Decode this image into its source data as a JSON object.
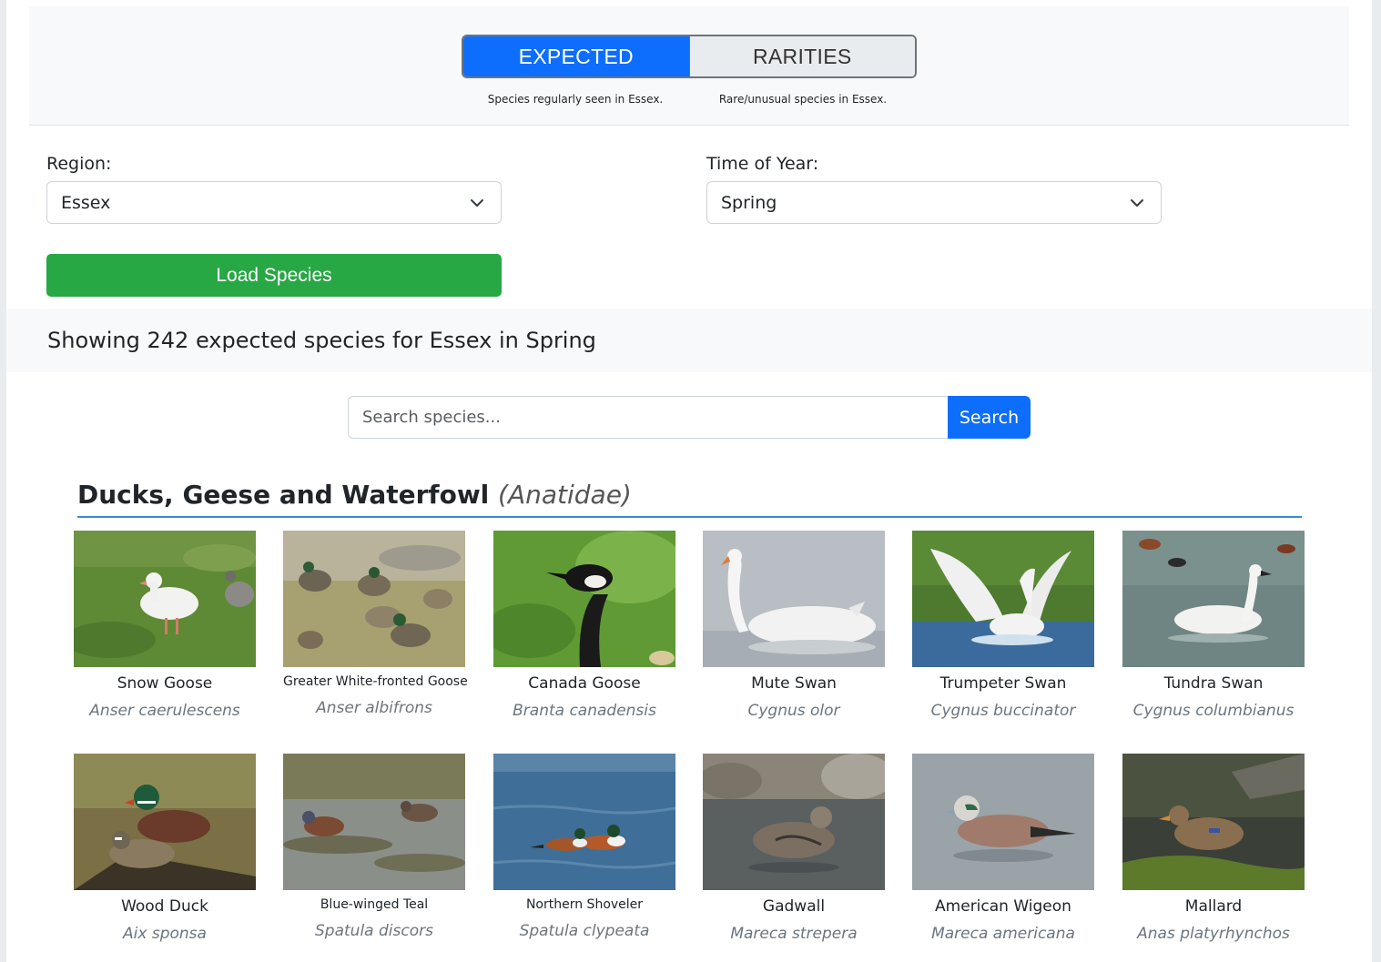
{
  "mode_toggle": {
    "expected_label": "EXPECTED",
    "rarities_label": "RARITIES",
    "expected_desc": "Species regularly seen in Essex.",
    "rarities_desc": "Rare/unusual species in Essex.",
    "active": "expected"
  },
  "filters": {
    "region_label": "Region:",
    "region_value": "Essex",
    "time_label": "Time of Year:",
    "time_value": "Spring",
    "load_label": "Load Species"
  },
  "status": {
    "text": "Showing 242 expected species for Essex in Spring"
  },
  "search": {
    "placeholder": "Search species...",
    "button_label": "Search"
  },
  "family": {
    "common": "Ducks, Geese and Waterfowl",
    "latin": "(Anatidae)"
  },
  "species": [
    {
      "common": "Snow Goose",
      "scientific": "Anser caerulescens"
    },
    {
      "common": "Greater White-fronted Goose",
      "scientific": "Anser albifrons"
    },
    {
      "common": "Canada Goose",
      "scientific": "Branta canadensis"
    },
    {
      "common": "Mute Swan",
      "scientific": "Cygnus olor"
    },
    {
      "common": "Trumpeter Swan",
      "scientific": "Cygnus buccinator"
    },
    {
      "common": "Tundra Swan",
      "scientific": "Cygnus columbianus"
    },
    {
      "common": "Wood Duck",
      "scientific": "Aix sponsa"
    },
    {
      "common": "Blue-winged Teal",
      "scientific": "Spatula discors"
    },
    {
      "common": "Northern Shoveler",
      "scientific": "Spatula clypeata"
    },
    {
      "common": "Gadwall",
      "scientific": "Mareca strepera"
    },
    {
      "common": "American Wigeon",
      "scientific": "Mareca americana"
    },
    {
      "common": "Mallard",
      "scientific": "Anas platyrhynchos"
    }
  ],
  "colors": {
    "primary": "#0d6efd",
    "success": "#28a745",
    "family_rule": "#3d8bd0"
  }
}
